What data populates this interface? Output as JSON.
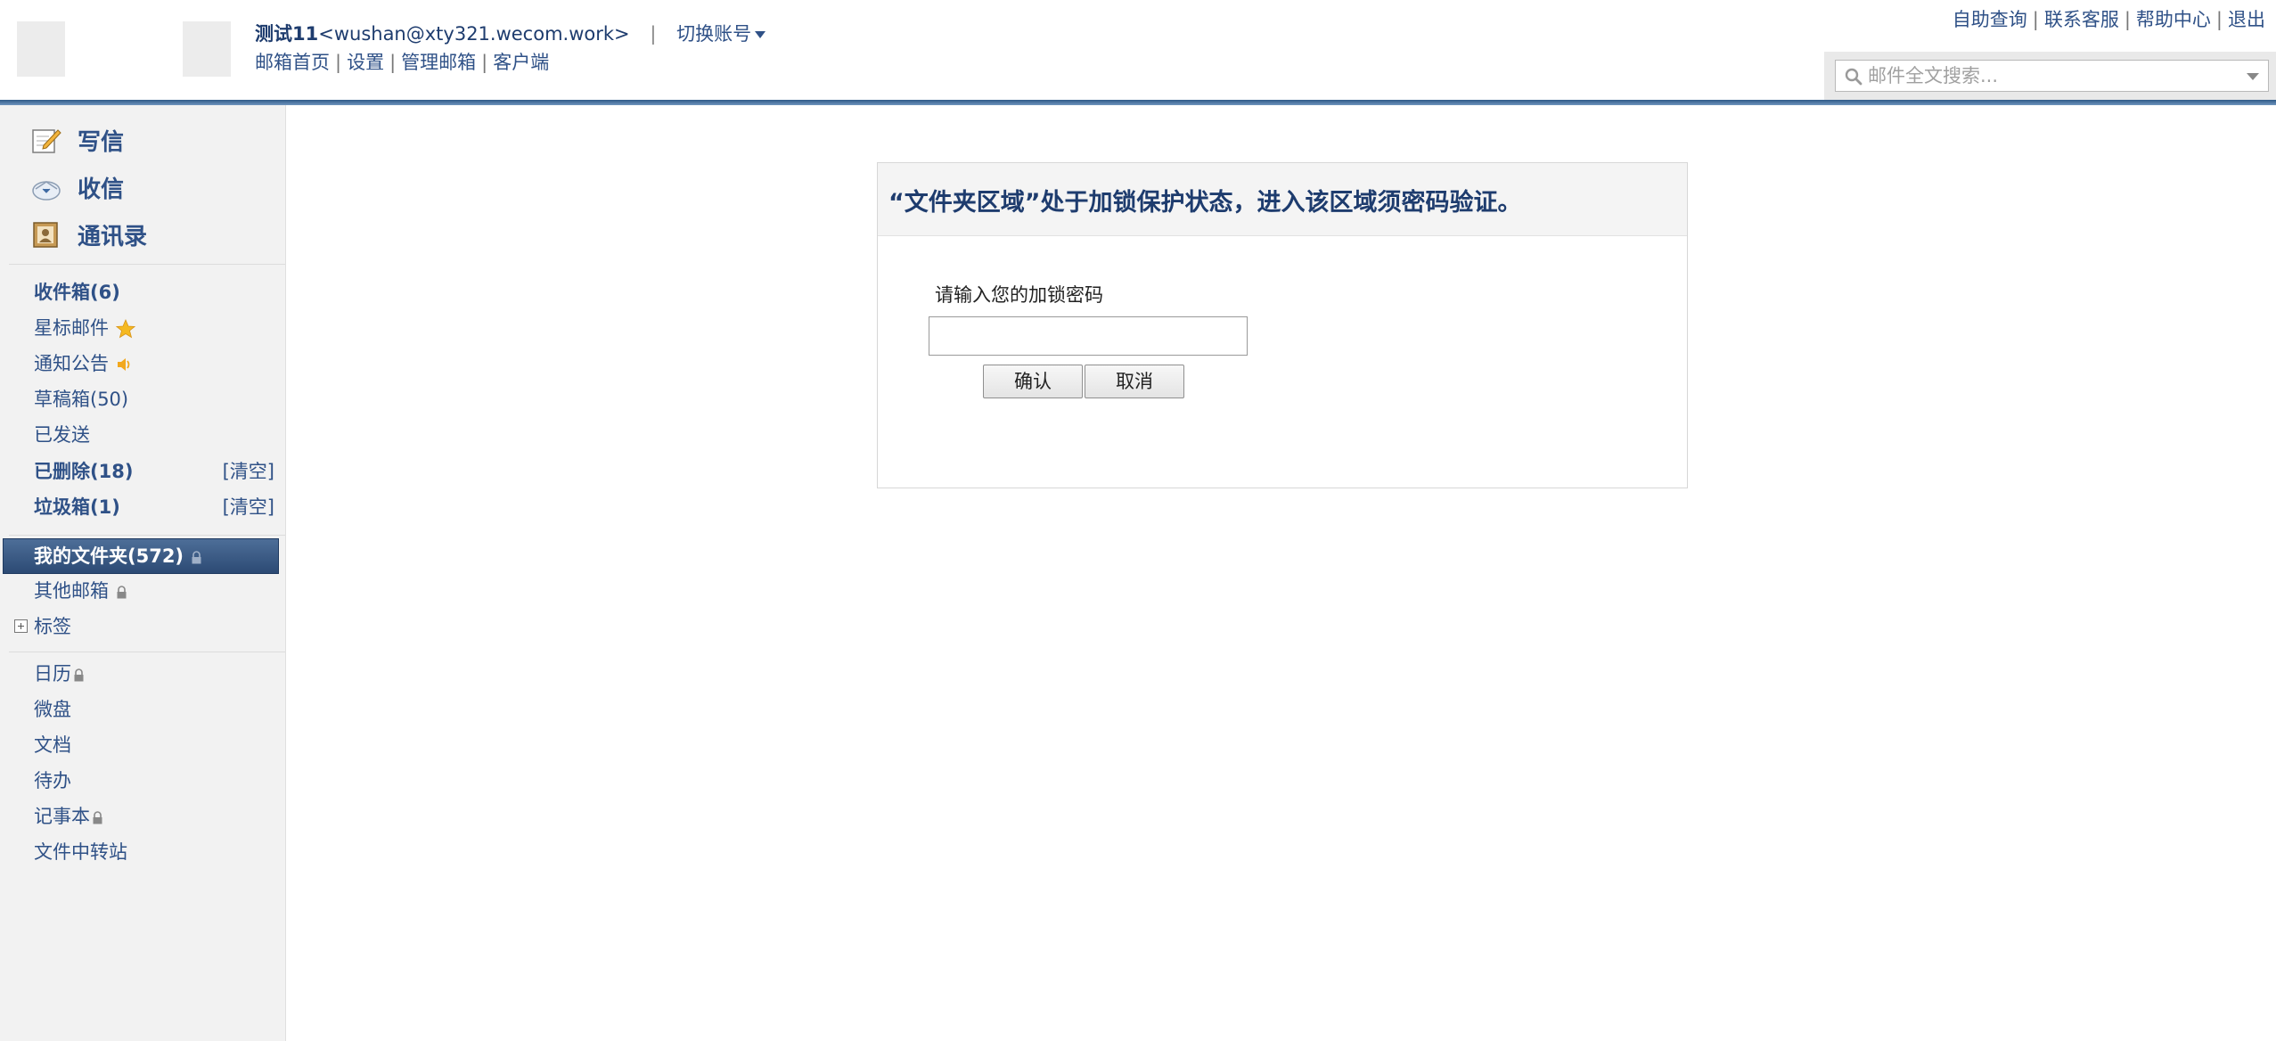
{
  "header": {
    "logo_text": "",
    "user_name": "测试11",
    "user_email": "<wushan@xty321.wecom.work>",
    "separator": "|",
    "switch_account": "切换账号",
    "nav": [
      "邮箱首页",
      "设置",
      "管理邮箱",
      "客户端"
    ],
    "top_links": [
      "自助查询",
      "联系客服",
      "帮助中心",
      "退出"
    ],
    "pipe": "|",
    "search_placeholder": "邮件全文搜索..."
  },
  "sidebar": {
    "actions": {
      "compose": "写信",
      "receive": "收信",
      "contacts": "通讯录"
    },
    "folders": {
      "inbox": "收件箱(6)",
      "starred": "星标邮件",
      "notices": "通知公告",
      "drafts": "草稿箱(50)",
      "sent": "已发送",
      "deleted": "已删除(18)",
      "spam": "垃圾箱(1)",
      "clear": "[清空]",
      "my_folders": "我的文件夹(572)",
      "other_mailboxes": "其他邮箱",
      "tags": "标签"
    },
    "apps": {
      "calendar": "日历",
      "disk": "微盘",
      "docs": "文档",
      "todo": "待办",
      "notes": "记事本",
      "transfer": "文件中转站"
    }
  },
  "lock_dialog": {
    "title": "“文件夹区域”处于加锁保护状态，进入该区域须密码验证。",
    "label": "请输入您的加锁密码",
    "password_value": "",
    "confirm": "确认",
    "cancel": "取消"
  },
  "colors": {
    "link": "#2f5187",
    "active_folder_bg": "#3d5d88",
    "header_rule": "#2f5a87"
  }
}
